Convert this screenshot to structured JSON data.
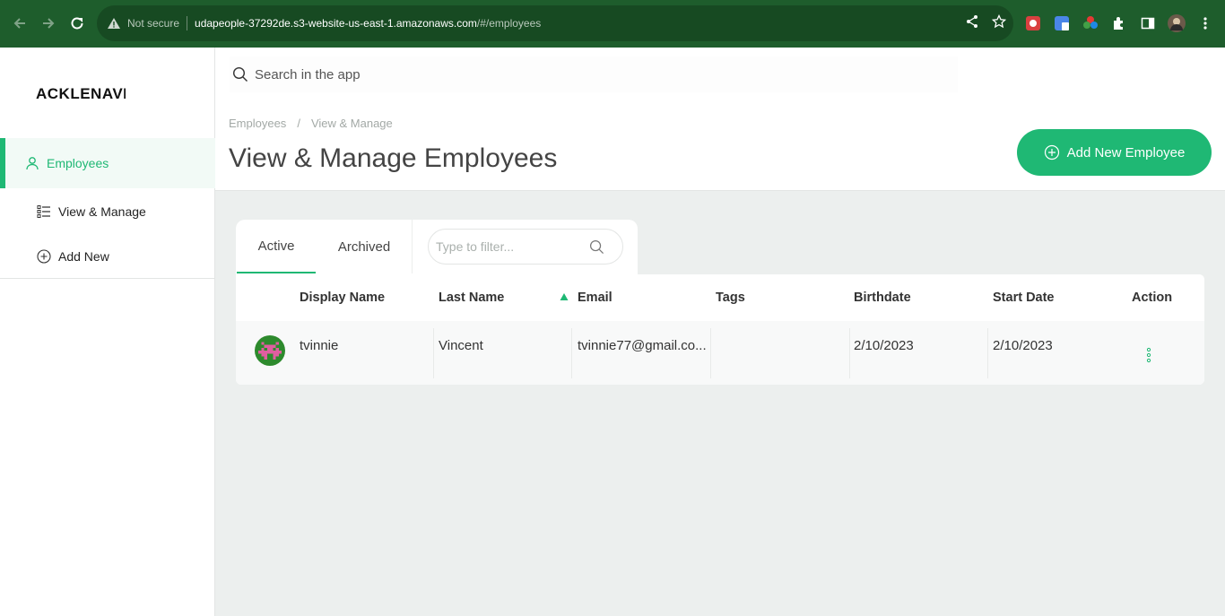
{
  "browser": {
    "insecure_label": "Not secure",
    "url_host": "udapeople-37292de.s3-website-us-east-1.amazonaws.com",
    "url_path": "/#/employees"
  },
  "sidebar": {
    "logo": "ACKLENAVENUE",
    "items": [
      {
        "label": "Employees",
        "icon": "user-icon"
      },
      {
        "label": "View & Manage",
        "icon": "list-icon"
      },
      {
        "label": "Add New",
        "icon": "plus-circle-icon"
      }
    ]
  },
  "header": {
    "search_placeholder": "Search in the app",
    "breadcrumb": [
      "Employees",
      "/",
      "View & Manage"
    ],
    "title": "View & Manage Employees",
    "add_button_label": "Add New Employee"
  },
  "tabs": {
    "items": [
      "Active",
      "Archived"
    ],
    "active": "Active",
    "filter_placeholder": "Type to filter..."
  },
  "table": {
    "columns": [
      "Display Name",
      "Last Name",
      "Email",
      "Tags",
      "Birthdate",
      "Start Date",
      "Action"
    ],
    "sorted_column": "Email",
    "rows": [
      {
        "display_name": "tvinnie",
        "last_name": "Vincent",
        "email": "tvinnie77@gmail.co...",
        "tags": "",
        "birthdate": "2/10/2023",
        "start_date": "2/10/2023"
      }
    ]
  },
  "colors": {
    "accent": "#1fb874",
    "chrome": "#1e5d2c",
    "background": "#ecefee"
  }
}
